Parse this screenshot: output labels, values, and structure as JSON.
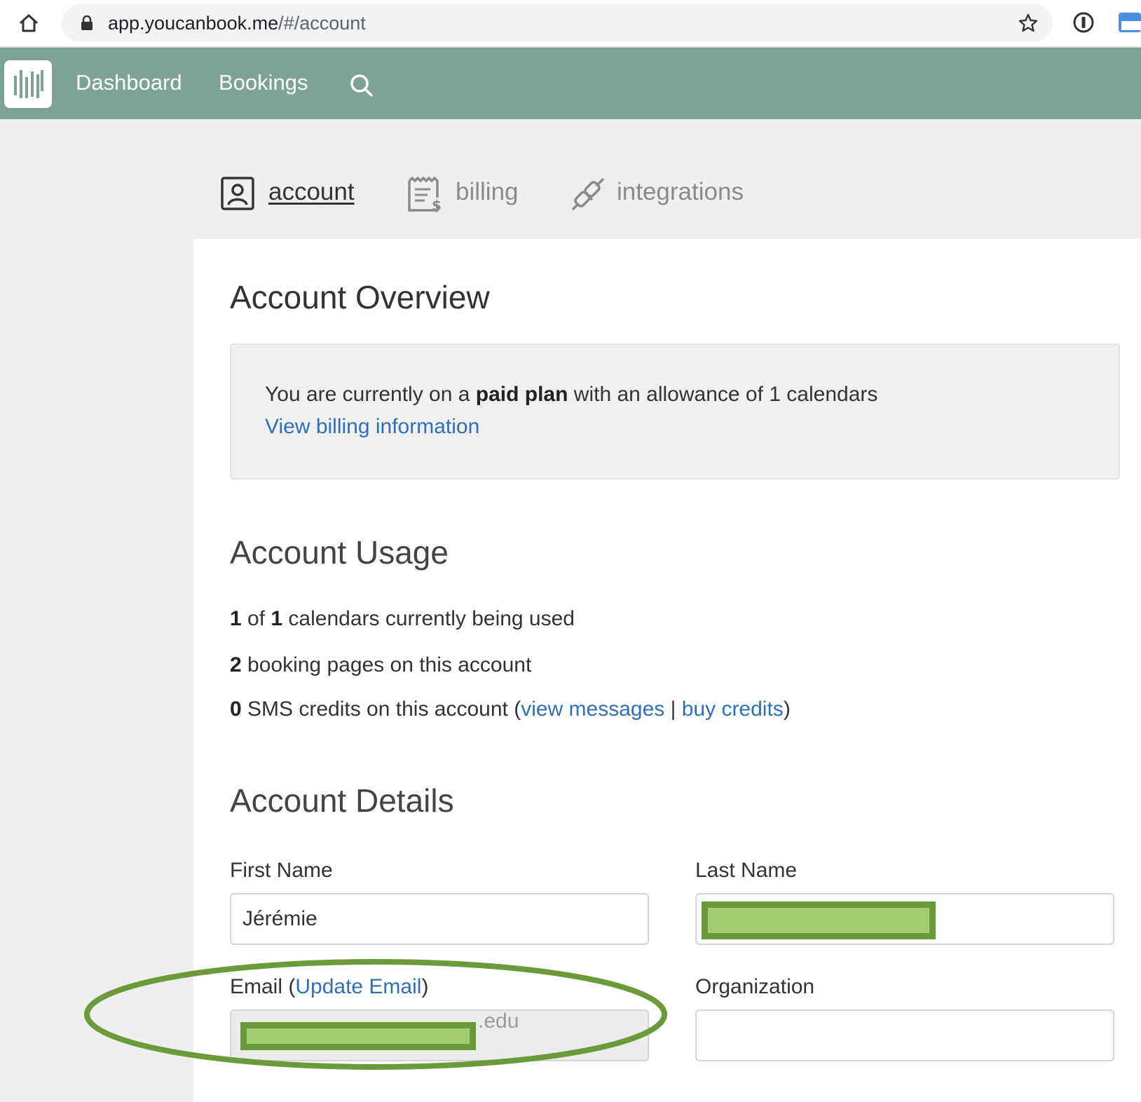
{
  "browser": {
    "url_host": "app.youcanbook.me",
    "url_path": "/#/account"
  },
  "nav": {
    "dashboard": "Dashboard",
    "bookings": "Bookings",
    "brand_color": "#7ba495"
  },
  "tabs": [
    {
      "label": "account",
      "active": true
    },
    {
      "label": "billing",
      "active": false
    },
    {
      "label": "integrations",
      "active": false
    }
  ],
  "overview": {
    "title": "Account Overview",
    "plan_prefix": "You are currently on a ",
    "plan_name": "paid plan",
    "plan_suffix": " with an allowance of 1 calendars",
    "billing_link": "View billing information"
  },
  "usage": {
    "title": "Account Usage",
    "calendars_used": "1",
    "calendars_of": " of ",
    "calendars_total": "1",
    "calendars_text": " calendars currently being used",
    "booking_pages": "2",
    "booking_pages_text": " booking pages on this account",
    "sms_credits": "0",
    "sms_text": " SMS credits on this account (",
    "view_messages": "view messages",
    "separator": " | ",
    "buy_credits": "buy credits",
    "close_paren": ")"
  },
  "details": {
    "title": "Account Details",
    "first_name_label": "First Name",
    "first_name_value": "Jérémie",
    "last_name_label": "Last Name",
    "email_label": "Email (",
    "update_email": "Update Email",
    "email_close": ")",
    "email_suffix": ".edu",
    "organization_label": "Organization",
    "organization_value": ""
  },
  "colors": {
    "link": "#2f6fb7",
    "redaction_fill": "#a2cf6e",
    "annotation": "#6b9a3a"
  }
}
